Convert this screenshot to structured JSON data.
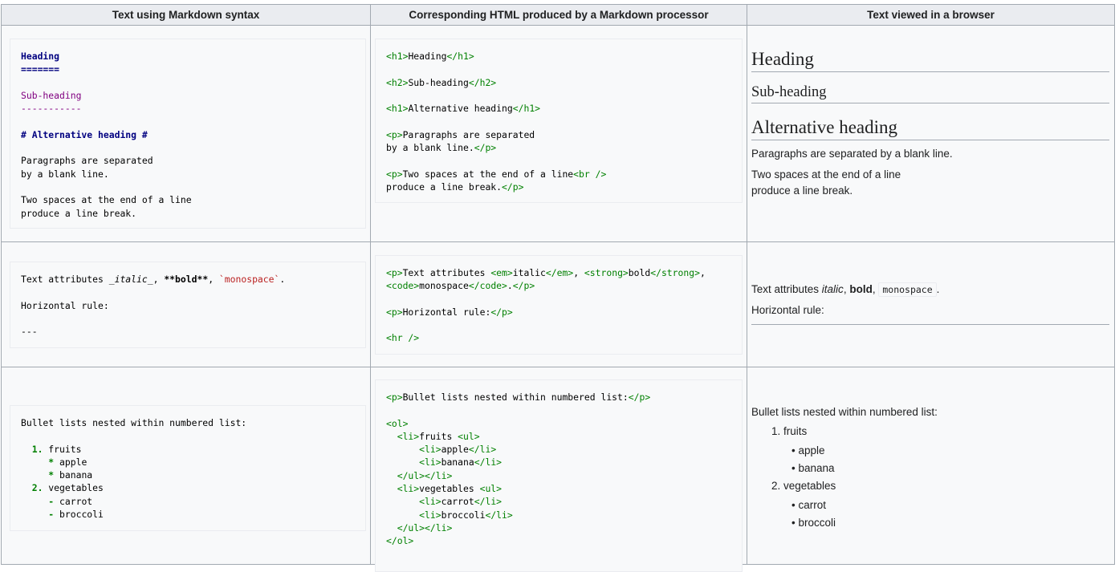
{
  "headers": {
    "col1": "Text using Markdown syntax",
    "col2": "Corresponding HTML produced by a Markdown processor",
    "col3": "Text viewed in a browser"
  },
  "row1": {
    "md": {
      "heading": "Heading",
      "heading_underline": "=======",
      "subheading": "Sub-heading",
      "subheading_underline": "-----------",
      "alt_heading": "# Alternative heading #",
      "para1_line1": "Paragraphs are separated",
      "para1_line2": "by a blank line.",
      "para2_line1": "Two spaces at the end of a line",
      "para2_line2": "produce a line break."
    },
    "html": {
      "h1_open": "<h1>",
      "h1_text": "Heading",
      "h1_close": "</h1>",
      "h2_open": "<h2>",
      "h2_text": "Sub-heading",
      "h2_close": "</h2>",
      "h1b_text": "Alternative heading",
      "p_open": "<p>",
      "p_close": "</p>",
      "p1_text_line1": "Paragraphs are separated",
      "p1_text_line2": "by a blank line.",
      "p2_text_line1": "Two spaces at the end of a line",
      "br_tag": "<br />",
      "p2_text_line2": "produce a line break."
    },
    "render": {
      "h1": "Heading",
      "h2": "Sub-heading",
      "h1b": "Alternative heading",
      "p1": "Paragraphs are separated by a blank line.",
      "p2_line1": "Two spaces at the end of a line",
      "p2_line2": "produce a line break."
    }
  },
  "row2": {
    "md": {
      "prefix": "Text attributes ",
      "italic": "_italic_",
      "sep1": ", ",
      "bold": "**bold**",
      "sep2": ", ",
      "mono": "`monospace`",
      "suffix": ".",
      "hr_label": "Horizontal rule:",
      "hr": "---"
    },
    "html": {
      "p_open": "<p>",
      "p_close": "</p>",
      "prefix": "Text attributes ",
      "em_open": "<em>",
      "em_text": "italic",
      "em_close": "</em>",
      "sep1": ", ",
      "strong_open": "<strong>",
      "strong_text": "bold",
      "strong_close": "</strong>",
      "sep2": ",",
      "code_open": "<code>",
      "code_text": "monospace",
      "code_close": "</code>",
      "suffix": ".",
      "hr_label": "Horizontal rule:",
      "hr_tag": "<hr />"
    },
    "render": {
      "prefix": "Text attributes ",
      "italic": "italic",
      "sep1": ", ",
      "bold": "bold",
      "sep2": ", ",
      "mono": "monospace",
      "suffix": ".",
      "hr_label": "Horizontal rule:"
    }
  },
  "row3": {
    "md": {
      "intro": "Bullet lists nested within numbered list:",
      "n1": "1.",
      "item1": "fruits",
      "star": "*",
      "apple": "apple",
      "banana": "banana",
      "n2": "2.",
      "item2": "vegetables",
      "dash": "-",
      "carrot": "carrot",
      "broccoli": "broccoli"
    },
    "html": {
      "p_open": "<p>",
      "p_close": "</p>",
      "intro": "Bullet lists nested within numbered list:",
      "ol_open": "<ol>",
      "ol_close": "</ol>",
      "li_open": "<li>",
      "li_close": "</li>",
      "ul_open": "<ul>",
      "ul_close": "</ul>",
      "fruits": "fruits ",
      "apple": "apple",
      "banana": "banana",
      "vegetables": "vegetables ",
      "carrot": "carrot",
      "broccoli": "broccoli"
    },
    "render": {
      "intro": "Bullet lists nested within numbered list:",
      "item1": "1. fruits",
      "apple": "apple",
      "banana": "banana",
      "item2": "2. vegetables",
      "carrot": "carrot",
      "broccoli": "broccoli"
    }
  }
}
